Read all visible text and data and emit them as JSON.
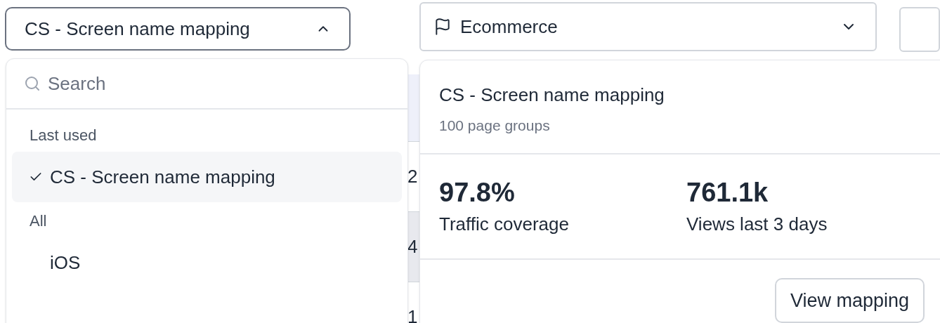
{
  "project_select": {
    "value": "CS - Screen name mapping",
    "expanded": true
  },
  "dashboard_select": {
    "value": "Ecommerce"
  },
  "background_table": {
    "rows": [
      {
        "column_1": "2",
        "selected": false
      },
      {
        "column_1": "4",
        "selected": true
      },
      {
        "column_1": "1",
        "selected": false
      }
    ]
  },
  "project_menu": {
    "search": {
      "placeholder": "Search"
    },
    "sections": [
      {
        "title": "Last used",
        "items": [
          {
            "label": "CS - Screen name mapping",
            "selected": true
          }
        ]
      },
      {
        "title": "All",
        "items": [
          {
            "label": "iOS",
            "selected": false
          }
        ]
      }
    ]
  },
  "project_card": {
    "title": "CS - Screen name mapping",
    "subtitle": "100 page groups",
    "stats": [
      {
        "value": "97.8%",
        "label": "Traffic coverage"
      },
      {
        "value": "761.1k",
        "label": "Views last 3 days"
      }
    ],
    "button": "View mapping"
  }
}
